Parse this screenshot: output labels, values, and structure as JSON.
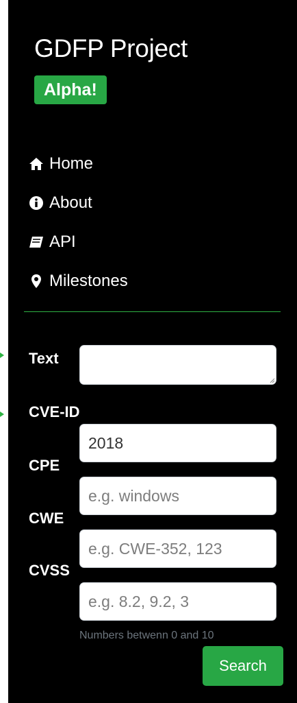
{
  "brand": {
    "title": "GDFP Project",
    "badge": "Alpha!"
  },
  "nav": [
    {
      "label": "Home",
      "icon": "home-icon"
    },
    {
      "label": "About",
      "icon": "info-circle-icon"
    },
    {
      "label": "API",
      "icon": "book-icon"
    },
    {
      "label": "Milestones",
      "icon": "map-marker-icon"
    }
  ],
  "form": {
    "text_label": "Text",
    "cve_label": "CVE-ID",
    "cve_value": "2018",
    "cpe_label": "CPE",
    "cpe_placeholder": "e.g. windows",
    "cwe_label": "CWE",
    "cwe_placeholder": "e.g. CWE-352, 123",
    "cvss_label": "CVSS",
    "cvss_placeholder": "e.g. 8.2, 9.2, 3",
    "cvss_hint": "Numbers betwenn 0 and 10",
    "search_label": "Search"
  },
  "colors": {
    "accent": "#28a745",
    "background": "#000000",
    "divider": "#2fb344"
  }
}
